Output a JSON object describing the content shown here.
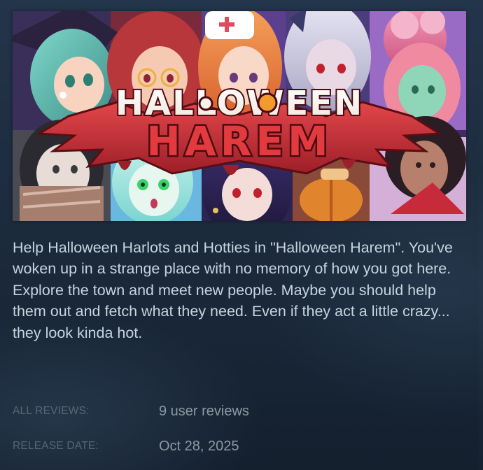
{
  "game": {
    "header_logo_line1": "HALLOWEEN",
    "header_logo_line2": "HAREM",
    "description": "Help Halloween Harlots and Hotties in \"Halloween Harem\". You've woken up in a strange place with no memory of how you got here. Explore the town and meet new people. Maybe you should help them out and fetch what they need. Even if they act a little crazy... they look kinda hot."
  },
  "info": {
    "reviews_label": "ALL REVIEWS:",
    "reviews_value": "9 user reviews",
    "release_label": "RELEASE DATE:",
    "release_value": "Oct 28, 2025"
  },
  "colors": {
    "page_bg": "#1b2838",
    "description_text": "#c6d4df",
    "label_text": "#556772",
    "value_text": "#8f98a0",
    "logo_red": "#d8343a",
    "logo_orange": "#f29a2e"
  }
}
